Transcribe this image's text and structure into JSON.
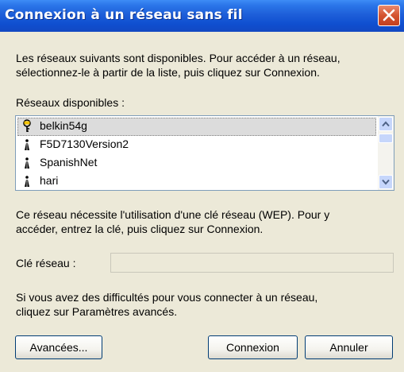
{
  "window": {
    "title": "Connexion à un réseau sans fil"
  },
  "intro": {
    "line1": "Les réseaux suivants sont disponibles. Pour accéder à un réseau,",
    "line2": "sélectionnez-le à partir de la liste, puis cliquez sur Connexion."
  },
  "networks_label": "Réseaux disponibles :",
  "networks": [
    {
      "name": "belkin54g",
      "icon": "secure-network-icon",
      "selected": true
    },
    {
      "name": "F5D7130Version2",
      "icon": "network-antenna-icon",
      "selected": false
    },
    {
      "name": "SpanishNet",
      "icon": "network-antenna-icon",
      "selected": false
    },
    {
      "name": "hari",
      "icon": "network-antenna-icon",
      "selected": false
    }
  ],
  "wep_info": {
    "line1": "Ce réseau nécessite l'utilisation d'une clé réseau (WEP). Pour y",
    "line2": "accéder, entrez la clé, puis cliquez sur Connexion."
  },
  "key_field": {
    "label": "Clé réseau :",
    "value": ""
  },
  "help": {
    "line1": "Si vous avez des difficultés pour vous connecter à un réseau,",
    "line2": "cliquez sur Paramètres avancés."
  },
  "buttons": {
    "advanced": "Avancées...",
    "connect": "Connexion",
    "cancel": "Annuler"
  },
  "colors": {
    "titlebar": "#0f4fd0",
    "face": "#ece9d8",
    "close": "#d4532f"
  }
}
